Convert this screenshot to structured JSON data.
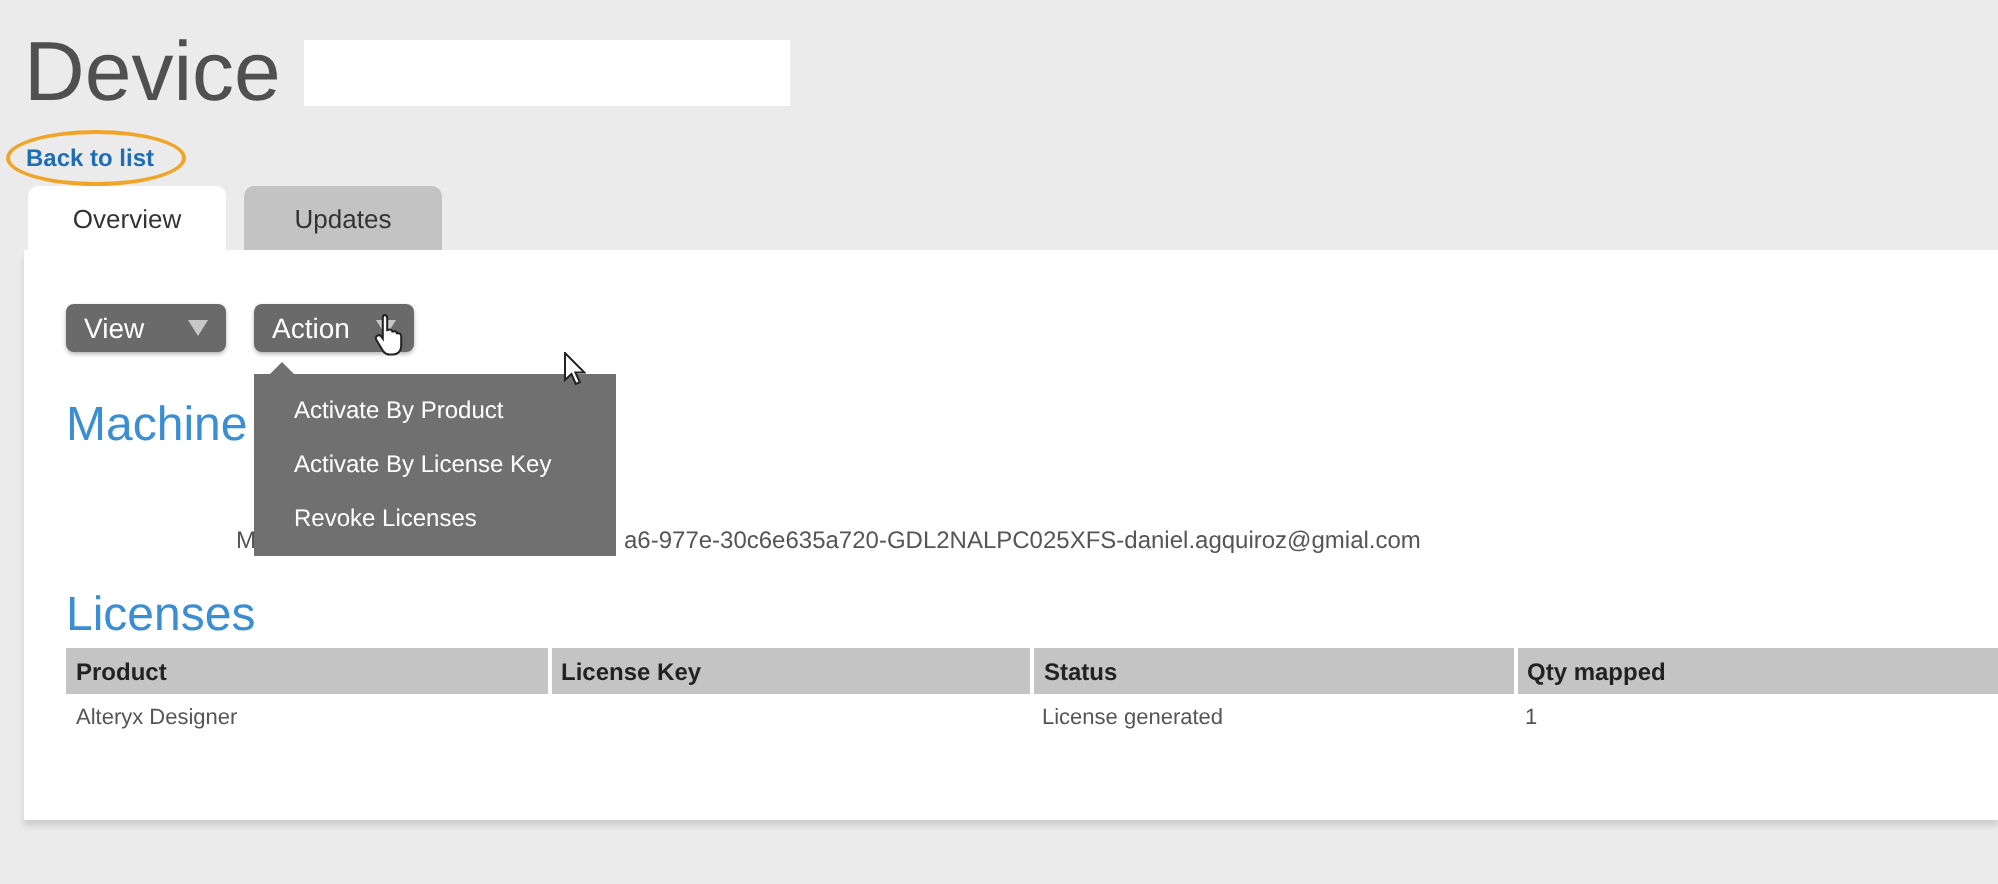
{
  "title": "Device",
  "back_link": "Back to list",
  "tabs": [
    {
      "label": "Overview",
      "selected": true
    },
    {
      "label": "Updates",
      "selected": false
    }
  ],
  "buttons": [
    {
      "label": "View",
      "expanded": false
    },
    {
      "label": "Action",
      "expanded": true,
      "menu_items": [
        "Activate By Product",
        "Activate By License Key",
        "Revoke Licenses"
      ]
    }
  ],
  "machine": {
    "heading": "Machine",
    "text_visible_start": "M",
    "text_visible_end": "a6-977e-30c6e635a720-GDL2NALPC025XFS-daniel.agquiroz@gmial.com"
  },
  "licenses": {
    "heading": "Licenses",
    "columns": [
      "Product",
      "License Key",
      "Status",
      "Qty mapped"
    ],
    "rows": [
      {
        "product": "Alteryx Designer",
        "status": "License generated",
        "qty_mapped": "1"
      }
    ]
  }
}
